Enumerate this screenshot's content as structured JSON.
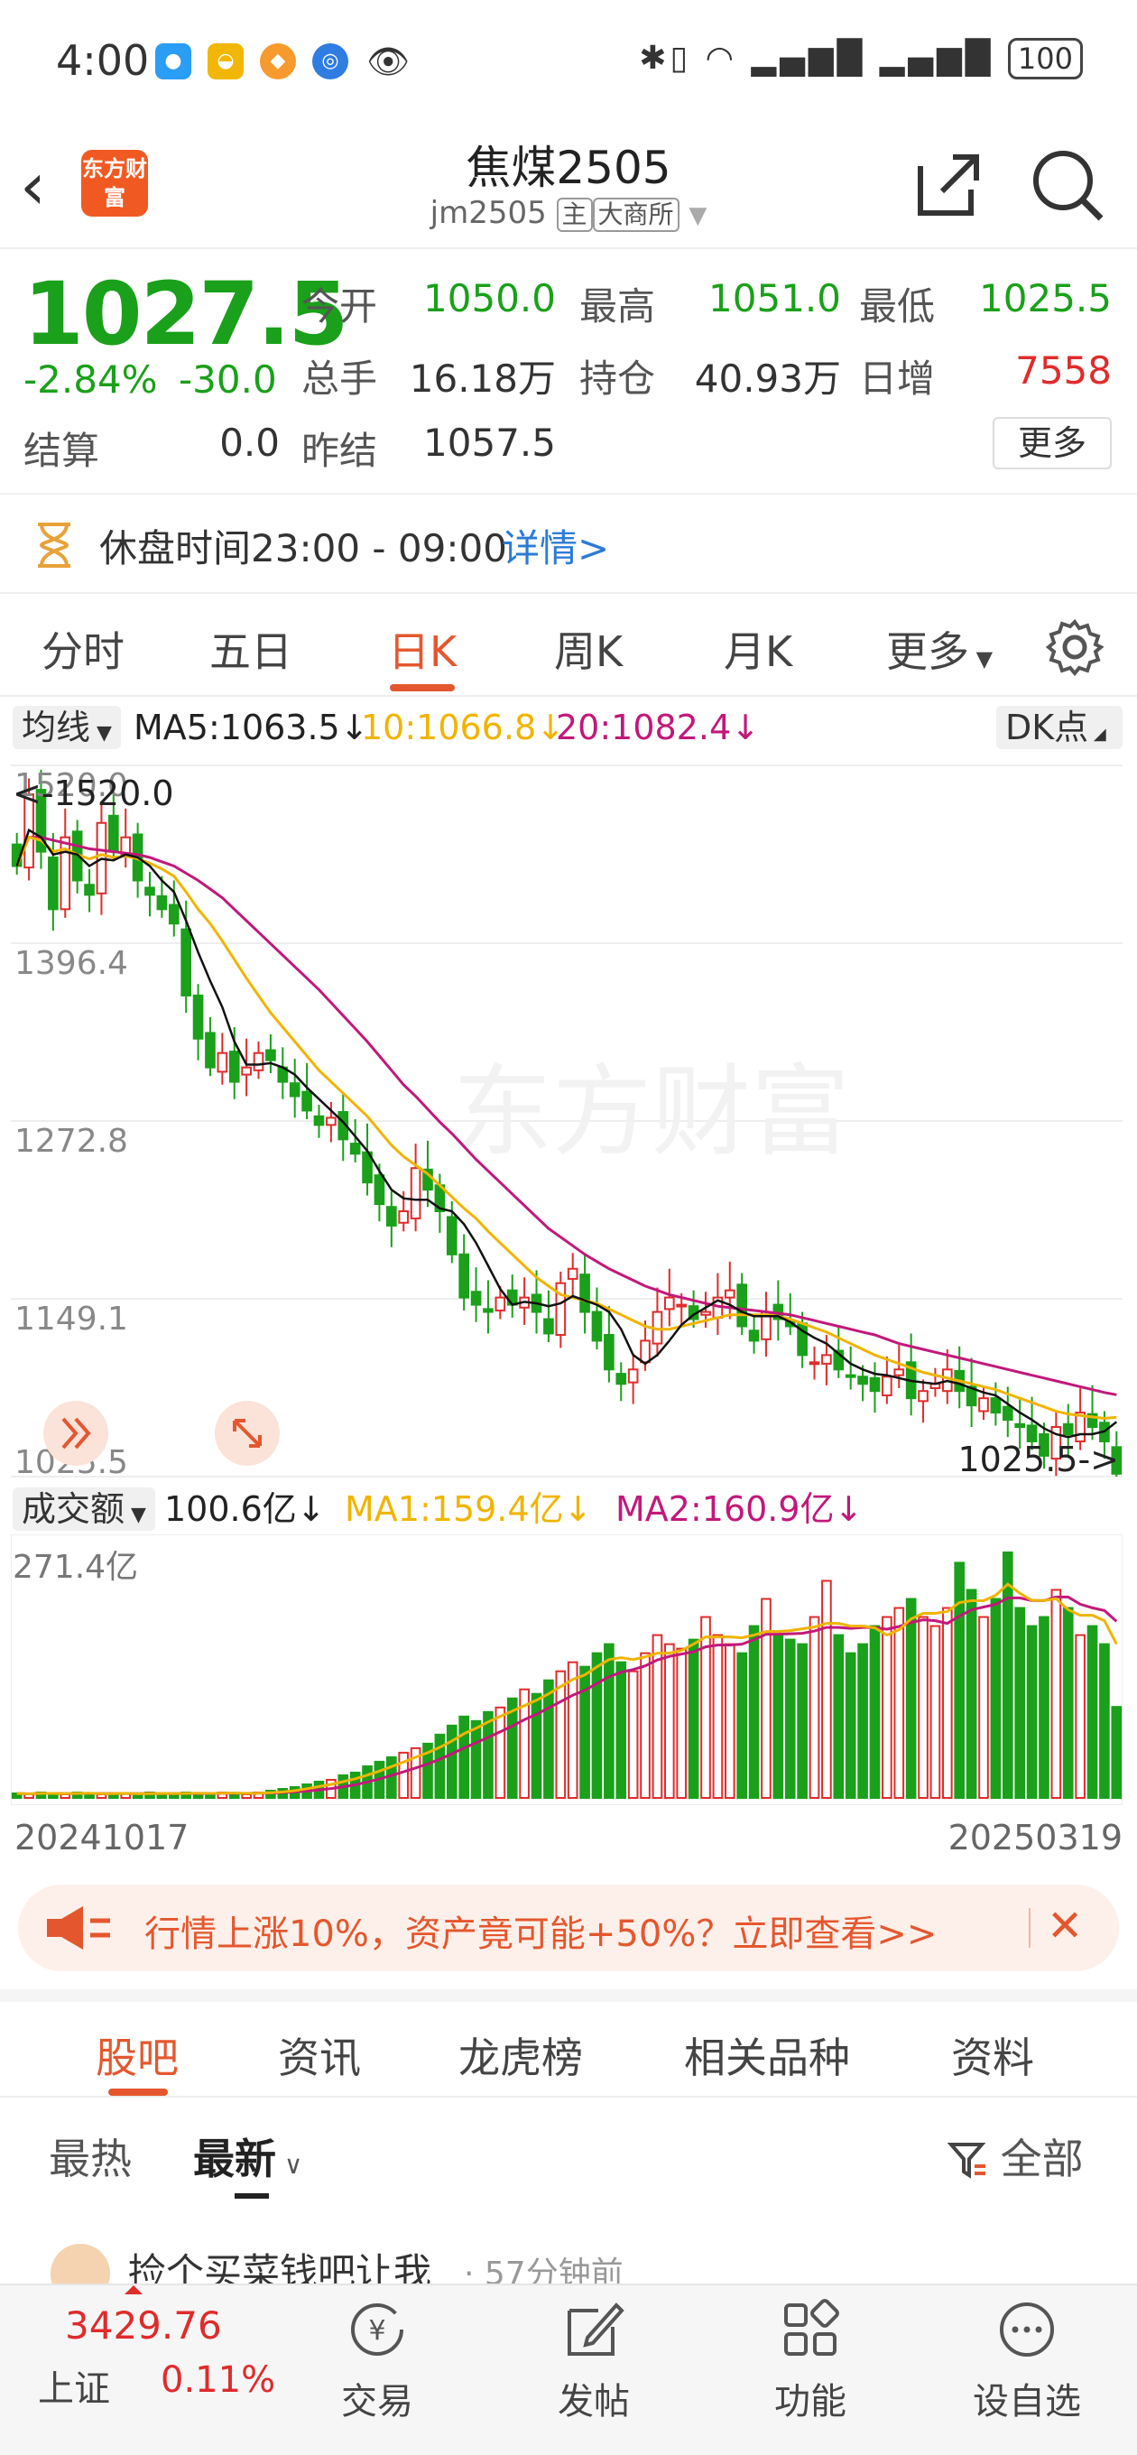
{
  "status_bar": {
    "time": "4:00",
    "battery": "100"
  },
  "header": {
    "title": "焦煤2505",
    "code": "jm2505",
    "tag_main": "主",
    "tag_exchange": "大商所",
    "logo_text": "东方财富"
  },
  "quote": {
    "price": "1027.5",
    "change_pct": "-2.84%",
    "change": "-30.0",
    "settle_label": "结算",
    "settle_value": "0.0",
    "open_label": "今开",
    "open_value": "1050.0",
    "high_label": "最高",
    "high_value": "1051.0",
    "low_label": "最低",
    "low_value": "1025.5",
    "volume_label": "总手",
    "volume_value": "16.18万",
    "oi_label": "持仓",
    "oi_value": "40.93万",
    "daily_inc_label": "日增",
    "daily_inc_value": "7558",
    "prev_settle_label": "昨结",
    "prev_settle_value": "1057.5",
    "more_label": "更多"
  },
  "notice": {
    "text": "休盘时间23:00 - 09:00",
    "link": "详情>"
  },
  "tabs": [
    "分时",
    "五日",
    "日K",
    "周K",
    "月K",
    "更多"
  ],
  "active_tab": "日K",
  "ma_bar": {
    "selector": "均线",
    "ma5": "MA5:1063.5↓",
    "ma10": "10:1066.8↓",
    "ma20": "20:1082.4↓",
    "dk": "DK点"
  },
  "chart_labels": {
    "y_ticks": [
      "1520.0",
      "1396.4",
      "1272.8",
      "1149.1",
      "1025.5"
    ],
    "max_marker": "<-1520.0",
    "min_marker": "1025.5->"
  },
  "vol_bar": {
    "selector": "成交额",
    "value": "100.6亿↓",
    "ma1": "MA1:159.4亿↓",
    "ma2": "MA2:160.9亿↓",
    "max_label": "271.4亿"
  },
  "dates": {
    "start": "20241017",
    "end": "20250319"
  },
  "ad": {
    "text": "行情上涨10%，资产竟可能+50%？立即查看>>"
  },
  "section_tabs": [
    "股吧",
    "资讯",
    "龙虎榜",
    "相关品种",
    "资料"
  ],
  "filter": {
    "hot": "最热",
    "new": "最新",
    "all": "全部"
  },
  "post": {
    "text": "捡个买菜钱吧让我",
    "time": "· 57分钟前"
  },
  "bottom_nav": {
    "index_value": "3429.76",
    "index_name": "上证",
    "index_change": "0.11%",
    "trade": "交易",
    "post": "发帖",
    "func": "功能",
    "custom": "设自选"
  },
  "colors": {
    "up": "#e02b2b",
    "down": "#1aa01a",
    "accent": "#e4572e",
    "ma5": "#111111",
    "ma10": "#f0b400",
    "ma20": "#c2187a"
  },
  "chart_data": {
    "type": "candlestick",
    "ylim": [
      1025.5,
      1520.0
    ],
    "x_range": [
      "20241017",
      "20250319"
    ],
    "close": [
      1450,
      1500,
      1460,
      1420,
      1470,
      1440,
      1430,
      1480,
      1460,
      1470,
      1440,
      1430,
      1420,
      1410,
      1360,
      1330,
      1310,
      1320,
      1300,
      1310,
      1320,
      1315,
      1300,
      1290,
      1280,
      1270,
      1275,
      1260,
      1250,
      1230,
      1215,
      1200,
      1210,
      1240,
      1225,
      1210,
      1180,
      1150,
      1145,
      1140,
      1150,
      1145,
      1150,
      1140,
      1125,
      1160,
      1170,
      1140,
      1120,
      1100,
      1090,
      1100,
      1120,
      1140,
      1150,
      1145,
      1135,
      1140,
      1150,
      1155,
      1130,
      1120,
      1140,
      1135,
      1130,
      1110,
      1105,
      1110,
      1100,
      1095,
      1090,
      1085,
      1095,
      1100,
      1080,
      1085,
      1090,
      1100,
      1085,
      1075,
      1080,
      1070,
      1065,
      1060,
      1050,
      1040,
      1060,
      1055,
      1070,
      1060,
      1050,
      1027.5
    ],
    "ma5": [
      1450,
      1475,
      1470,
      1458,
      1460,
      1458,
      1450,
      1455,
      1454,
      1458,
      1456,
      1450,
      1440,
      1432,
      1412,
      1390,
      1370,
      1352,
      1328,
      1312,
      1312,
      1313,
      1310,
      1305,
      1296,
      1288,
      1280,
      1272,
      1262,
      1252,
      1238,
      1225,
      1219,
      1218,
      1218,
      1212,
      1210,
      1201,
      1188,
      1172,
      1156,
      1145,
      1147,
      1146,
      1144,
      1146,
      1151,
      1148,
      1145,
      1140,
      1128,
      1110,
      1104,
      1110,
      1120,
      1131,
      1138,
      1143,
      1148,
      1145,
      1140,
      1137,
      1137,
      1137,
      1133,
      1127,
      1122,
      1118,
      1111,
      1104,
      1100,
      1097,
      1096,
      1094,
      1092,
      1091,
      1090,
      1092,
      1090,
      1087,
      1084,
      1082,
      1076,
      1070,
      1065,
      1059,
      1055,
      1053,
      1055,
      1055,
      1057,
      1063.5
    ],
    "ma10": [
      1450,
      1470,
      1468,
      1460,
      1462,
      1458,
      1455,
      1458,
      1456,
      1457,
      1455,
      1452,
      1448,
      1443,
      1432,
      1420,
      1410,
      1398,
      1385,
      1372,
      1360,
      1348,
      1338,
      1328,
      1318,
      1308,
      1300,
      1292,
      1284,
      1276,
      1266,
      1256,
      1248,
      1242,
      1236,
      1228,
      1220,
      1212,
      1205,
      1196,
      1188,
      1180,
      1172,
      1164,
      1158,
      1152,
      1150,
      1148,
      1146,
      1142,
      1138,
      1134,
      1130,
      1128,
      1128,
      1130,
      1132,
      1134,
      1136,
      1138,
      1138,
      1138,
      1138,
      1137,
      1135,
      1132,
      1129,
      1126,
      1122,
      1118,
      1114,
      1110,
      1107,
      1104,
      1101,
      1098,
      1096,
      1094,
      1092,
      1090,
      1088,
      1086,
      1083,
      1080,
      1077,
      1074,
      1071,
      1069,
      1068,
      1067,
      1066,
      1066.8
    ],
    "ma20": [
      1450,
      1470,
      1470,
      1468,
      1466,
      1464,
      1462,
      1461,
      1460,
      1459,
      1458,
      1456,
      1453,
      1450,
      1445,
      1440,
      1434,
      1428,
      1420,
      1412,
      1404,
      1396,
      1388,
      1380,
      1372,
      1364,
      1355,
      1346,
      1337,
      1328,
      1318,
      1308,
      1298,
      1290,
      1281,
      1272,
      1264,
      1255,
      1246,
      1238,
      1230,
      1222,
      1214,
      1206,
      1198,
      1192,
      1186,
      1180,
      1175,
      1170,
      1166,
      1162,
      1158,
      1155,
      1152,
      1150,
      1148,
      1146,
      1144,
      1143,
      1142,
      1141,
      1140,
      1139,
      1138,
      1136,
      1134,
      1132,
      1130,
      1128,
      1126,
      1124,
      1121,
      1118,
      1116,
      1114,
      1112,
      1110,
      1108,
      1106,
      1104,
      1102,
      1100,
      1098,
      1096,
      1094,
      1092,
      1090,
      1088,
      1086,
      1084,
      1082.4
    ],
    "volume_max": 271.4,
    "volume": [
      5,
      4,
      6,
      5,
      4,
      6,
      5,
      4,
      5,
      5,
      4,
      6,
      5,
      4,
      6,
      5,
      5,
      6,
      5,
      4,
      6,
      8,
      10,
      12,
      15,
      18,
      20,
      25,
      28,
      35,
      40,
      45,
      50,
      55,
      60,
      70,
      80,
      90,
      85,
      95,
      100,
      110,
      120,
      115,
      130,
      140,
      150,
      145,
      160,
      170,
      150,
      140,
      160,
      180,
      170,
      165,
      175,
      200,
      180,
      170,
      160,
      190,
      220,
      180,
      175,
      170,
      200,
      240,
      180,
      160,
      170,
      190,
      200,
      210,
      220,
      200,
      190,
      210,
      260,
      230,
      200,
      220,
      271.4,
      210,
      190,
      200,
      230,
      210,
      180,
      190,
      170,
      100.6
    ]
  }
}
